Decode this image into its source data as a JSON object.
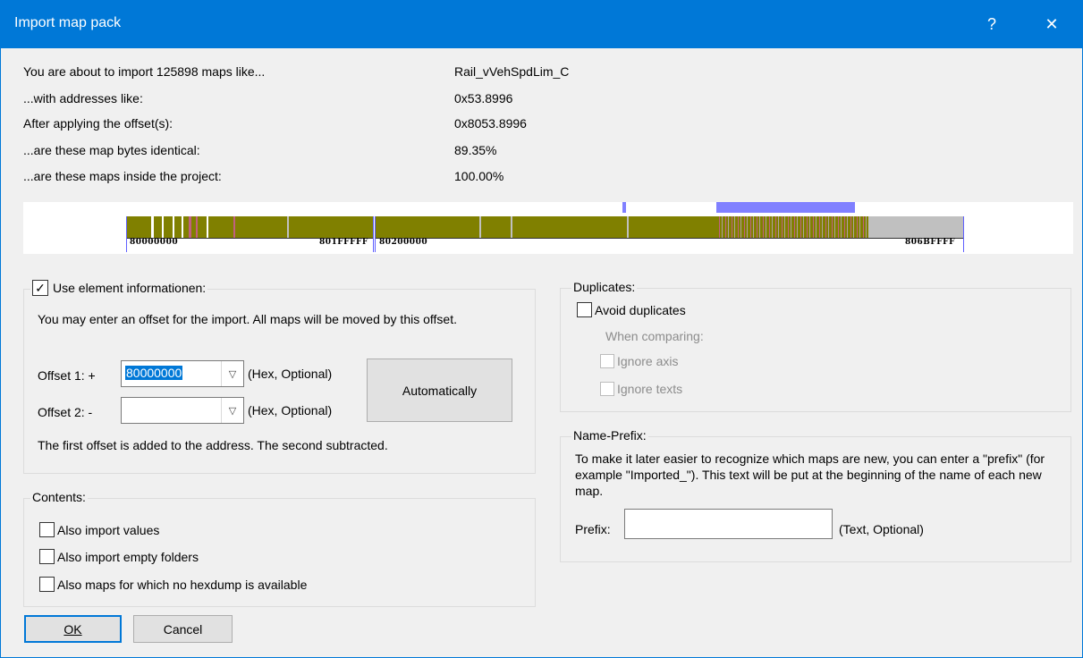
{
  "dialog": {
    "title": "Import map pack",
    "help_glyph": "?",
    "close_glyph": "✕"
  },
  "summary": {
    "rows": [
      {
        "label": "You are about to import 125898 maps like...",
        "value": "Rail_vVehSpdLim_C"
      },
      {
        "label": "...with addresses like:",
        "value": "0x53.8996"
      },
      {
        "label": "After applying the offset(s):",
        "value": "0x8053.8996"
      },
      {
        "label": "...are these map bytes identical:",
        "value": "89.35%"
      },
      {
        "label": "...are these maps inside the project:",
        "value": "100.00%"
      }
    ]
  },
  "memory_map": {
    "addresses": [
      "80000000",
      "801FFFFF",
      "80200000",
      "806BFFFF"
    ],
    "colors": {
      "olive": "#808000",
      "grey": "#c0c0c0",
      "highlight": "#8080ff",
      "rose": "#c06080"
    }
  },
  "element_info": {
    "checkbox_label": "Use element informationen:",
    "checked": true,
    "description": "You may enter an offset for the import. All maps will be moved by this offset.",
    "offset1_label": "Offset 1: +",
    "offset1_value": "80000000",
    "offset1_hint": "(Hex, Optional)",
    "offset2_label": "Offset 2: -",
    "offset2_value": "",
    "offset2_hint": "(Hex, Optional)",
    "auto_button": "Automatically",
    "footnote": "The first offset is added to the address. The second subtracted."
  },
  "contents": {
    "group_label": "Contents:",
    "options": [
      "Also import values",
      "Also import empty folders",
      "Also maps for which no hexdump is available"
    ]
  },
  "duplicates": {
    "group_label": "Duplicates:",
    "avoid_label": "Avoid duplicates",
    "when_comparing": "When comparing:",
    "ignore_axis": "Ignore axis",
    "ignore_texts": "Ignore texts"
  },
  "name_prefix": {
    "group_label": "Name-Prefix:",
    "description": "To make it later easier to recognize which maps are new, you can enter a \"prefix\" (for example \"Imported_\"). This text will be put at the beginning of the name of each new map.",
    "prefix_label": "Prefix:",
    "prefix_value": "",
    "prefix_hint": "(Text, Optional)"
  },
  "buttons": {
    "ok": "OK",
    "cancel": "Cancel"
  }
}
